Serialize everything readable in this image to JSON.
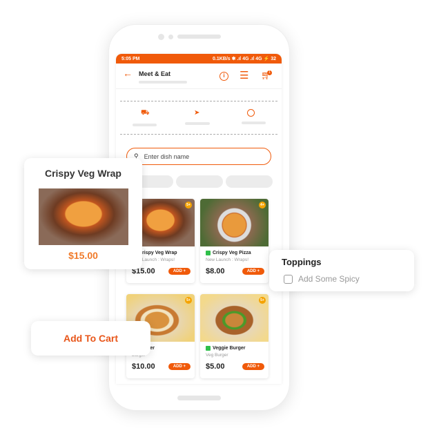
{
  "status_bar": {
    "time": "5:05 PM",
    "info": "0.1KB/s ✱ .ıl 4G .ıl 4G ⚡ 32"
  },
  "header": {
    "title": "Meet & Eat",
    "cart_count": "1"
  },
  "search": {
    "placeholder": "Enter dish name"
  },
  "items": [
    {
      "name": "Crispy Veg Wrap",
      "subtitle": "New Launch : Wraps!",
      "price": "$15.00",
      "badge": "5+",
      "add_label": "ADD +"
    },
    {
      "name": "Crispy Veg Pizza",
      "subtitle": "New Launch : Wraps!",
      "price": "$8.00",
      "badge": "4+",
      "add_label": "ADD +"
    },
    {
      "name": "Burger",
      "subtitle": "Burger",
      "price": "$10.00",
      "badge": "5+",
      "add_label": "ADD +"
    },
    {
      "name": "Veggie Burger",
      "subtitle": "Veg Burger",
      "price": "$5.00",
      "badge": "5+",
      "add_label": "ADD +"
    }
  ],
  "popup_item": {
    "name": "Crispy Veg Wrap",
    "price": "$15.00"
  },
  "add_to_cart": {
    "label": "Add To Cart"
  },
  "toppings": {
    "title": "Toppings",
    "option": "Add Some Spicy",
    "checked": false
  },
  "colors": {
    "accent": "#f05a0a",
    "price": "#f07a2a"
  }
}
